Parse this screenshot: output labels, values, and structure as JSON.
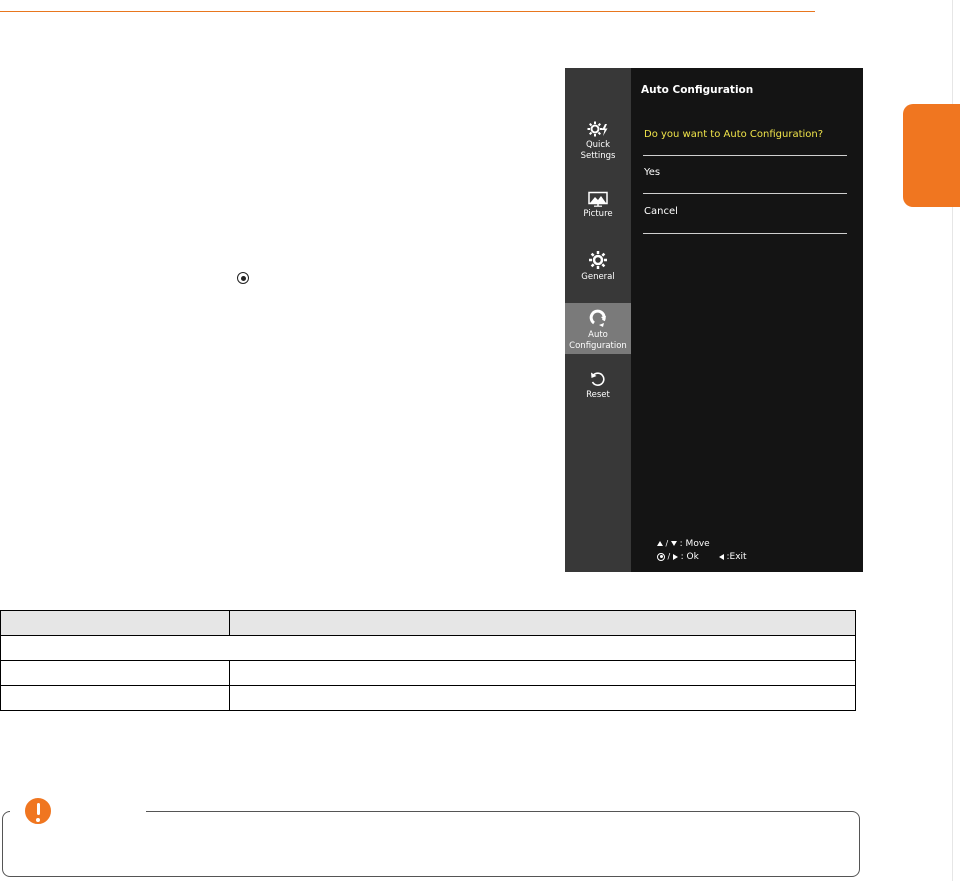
{
  "page": {
    "accent_color": "#f07620"
  },
  "osd": {
    "title": "Auto Configuration",
    "question": "Do you want to Auto Configuration?",
    "options": [
      "Yes",
      "Cancel"
    ],
    "nav_items": [
      {
        "label_lines": [
          "Quick",
          "Settings"
        ],
        "icon": "quick-settings-icon"
      },
      {
        "label_lines": [
          "Picture"
        ],
        "icon": "picture-icon"
      },
      {
        "label_lines": [
          "General"
        ],
        "icon": "general-icon"
      },
      {
        "label_lines": [
          "Auto",
          "Configuration"
        ],
        "icon": "auto-configuration-icon",
        "active": true
      },
      {
        "label_lines": [
          "Reset"
        ],
        "icon": "reset-icon"
      }
    ],
    "hints": {
      "move_label": ": Move",
      "ok_label": ": Ok",
      "exit_label": ":Exit"
    },
    "colors": {
      "background": "#141414",
      "sidebar": "#383838",
      "active_item": "#7a7a7a",
      "question_text": "#f0e44a"
    }
  }
}
